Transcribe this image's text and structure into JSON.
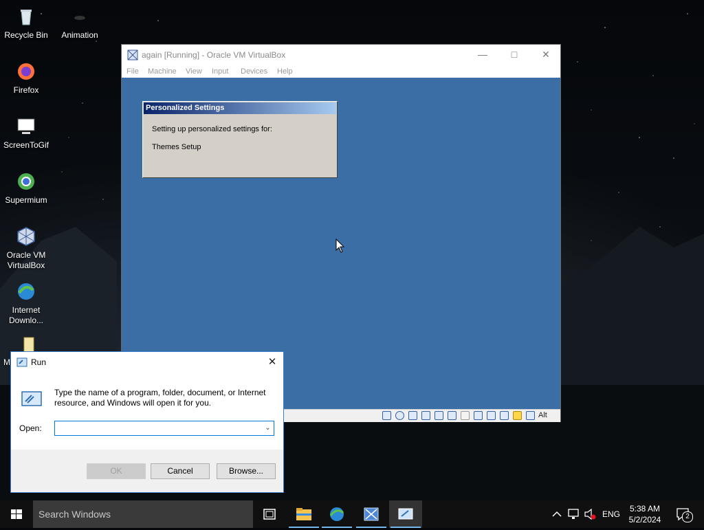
{
  "desktop": {
    "icons": [
      {
        "label": "Recycle Bin"
      },
      {
        "label": "Animation"
      },
      {
        "label": "Firefox"
      },
      {
        "label": "ScreenToGif"
      },
      {
        "label": "Supermium"
      },
      {
        "label": "Oracle VM VirtualBox"
      },
      {
        "label": "Internet Downlo..."
      },
      {
        "label": "M"
      }
    ]
  },
  "vbox": {
    "title": "again [Running] - Oracle VM VirtualBox",
    "menu": [
      "File",
      "Machine",
      "View",
      "Input",
      "Devices",
      "Help"
    ],
    "status_host_key": "Alt",
    "colors": {
      "vm_background": "#3a6ea5"
    }
  },
  "xp_dialog": {
    "title": "Personalized Settings",
    "line1": "Setting up personalized settings for:",
    "line2": "Themes Setup"
  },
  "run_dialog": {
    "title": "Run",
    "description": "Type the name of a program, folder, document, or Internet resource, and Windows will open it for you.",
    "open_label": "Open:",
    "open_value": "",
    "ok_label": "OK",
    "cancel_label": "Cancel",
    "browse_label": "Browse..."
  },
  "taskbar": {
    "search_placeholder": "Search Windows",
    "language": "ENG",
    "time": "5:38 AM",
    "date": "5/2/2024",
    "notification_count": "2",
    "colors": {
      "active_underline": "#76b9ed"
    }
  }
}
